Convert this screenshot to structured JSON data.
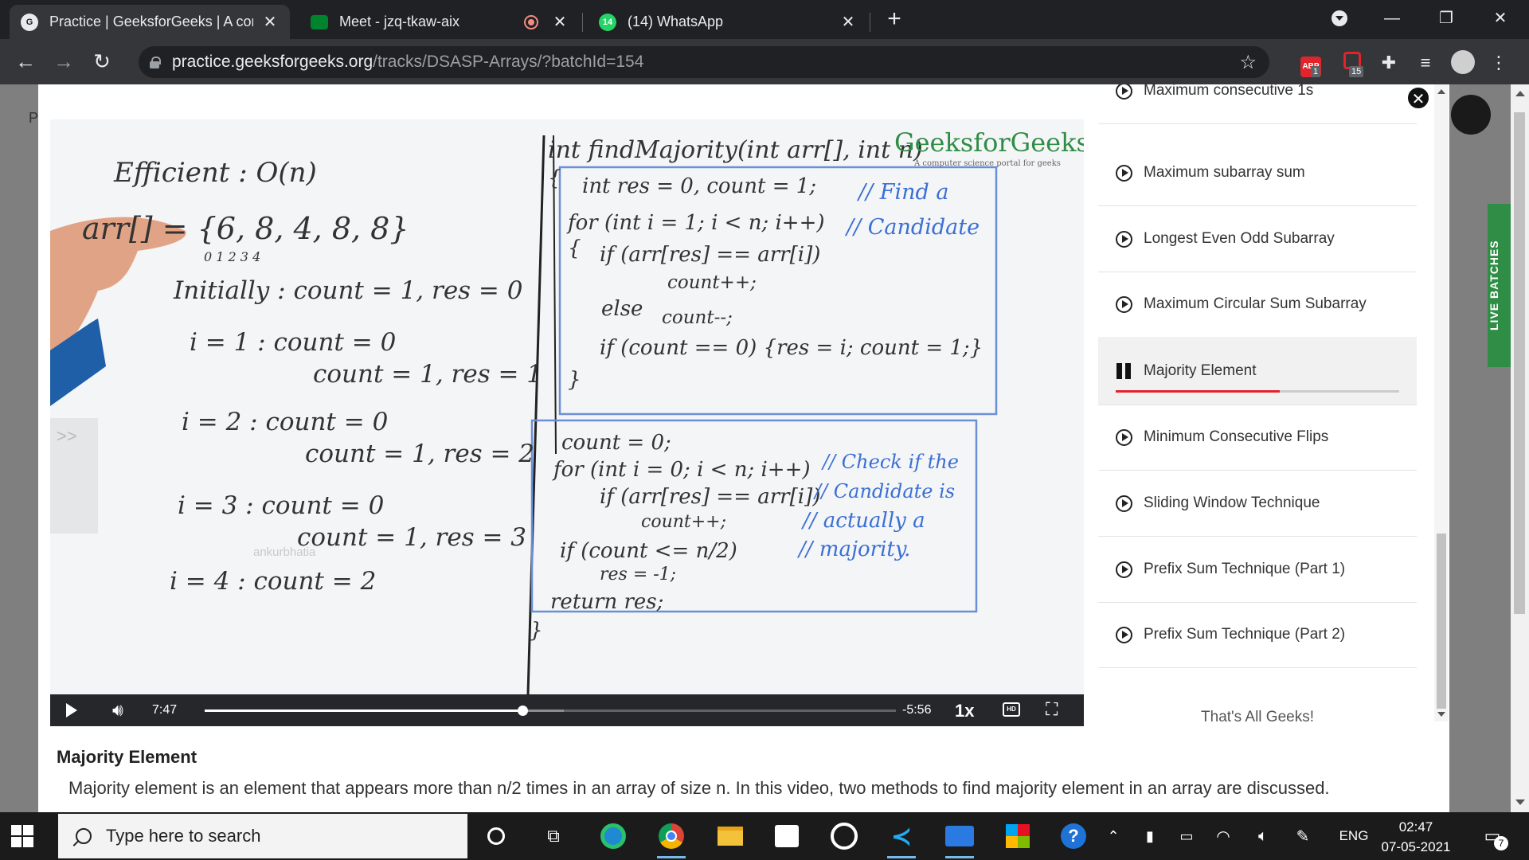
{
  "browser": {
    "tabs": [
      {
        "title": "Practice | GeeksforGeeks | A comp",
        "active": true
      },
      {
        "title": "Meet - jzq-tkaw-aix",
        "active": false
      },
      {
        "title": "(14) WhatsApp",
        "active": false
      }
    ],
    "whatsapp_count": "14",
    "url_host": "practice.geeksforgeeks.org",
    "url_path": "/tracks/DSASP-Arrays/?batchId=154",
    "ext_badges": {
      "abp": "1",
      "ext2": "15"
    }
  },
  "video": {
    "brand": "GeeksforGeeks",
    "brand_tagline": "A computer science portal for geeks",
    "current_time": "7:47",
    "remaining_time": "-5:56",
    "speed": "1x",
    "progress": 0.46,
    "buffered": 0.52,
    "watermark": "ankurbhatia",
    "skip_label": ">>",
    "board": {
      "left_lines": [
        "Efficient : O(n)",
        "arr[] = {6, 8, 4, 8, 8}",
        "0    1    2    3    4",
        "Initially :  count = 1,  res = 0",
        "i = 1  :   count = 0",
        "count = 1,  res = 1",
        "i = 2  :   count = 0",
        "count = 1,  res = 2",
        "i = 3  :   count = 0",
        "count = 1,   res = 3",
        "i = 4  :   count = 2"
      ],
      "code_lines": [
        "int findMajority(int arr[], int n)",
        "{",
        "int res = 0,  count = 1;",
        "for (int i = 1;  i < n;  i++)",
        "{",
        "if (arr[res] == arr[i])",
        "count++;",
        "else",
        "count--;",
        "if (count == 0)  {res = i;  count = 1;}",
        "}",
        "count = 0;",
        "for (int i = 0;  i < n;  i++)",
        "if (arr[res] == arr[i])",
        "count++;",
        "if (count <= n/2)",
        "res = -1;",
        "return res;",
        "}"
      ],
      "notes_top": [
        "// Find a",
        "// Candidate"
      ],
      "notes_bottom": [
        "// Check if the",
        "// Candidate is",
        "// actually a",
        "// majority."
      ]
    }
  },
  "playlist": {
    "items": [
      {
        "label": "Maximum consecutive 1s",
        "state": "play"
      },
      {
        "label": "Maximum subarray sum",
        "state": "play"
      },
      {
        "label": "Longest Even Odd Subarray",
        "state": "play"
      },
      {
        "label": "Maximum Circular Sum Subarray",
        "state": "play"
      },
      {
        "label": "Majority Element",
        "state": "playing",
        "progress": 0.58
      },
      {
        "label": "Minimum Consecutive Flips",
        "state": "play"
      },
      {
        "label": "Sliding Window Technique",
        "state": "play"
      },
      {
        "label": "Prefix Sum Technique (Part 1)",
        "state": "play"
      },
      {
        "label": "Prefix Sum Technique (Part 2)",
        "state": "play"
      }
    ],
    "end_text": "That's All Geeks!"
  },
  "description": {
    "title": "Majority Element",
    "text": "Majority element is an element that appears more than n/2 times in an array of size n. In this video, two methods to find majority element in an array are discussed."
  },
  "side": {
    "live_batches": "LIVE BATCHES",
    "page_letter": "P"
  },
  "taskbar": {
    "search_placeholder": "Type here to search",
    "language": "ENG",
    "time": "02:47",
    "date": "07-05-2021",
    "notifications": "7"
  },
  "colors": {
    "gfg_green": "#2f8d46",
    "marker_blue": "#3b6fd4",
    "accent_red": "#e4222c"
  }
}
